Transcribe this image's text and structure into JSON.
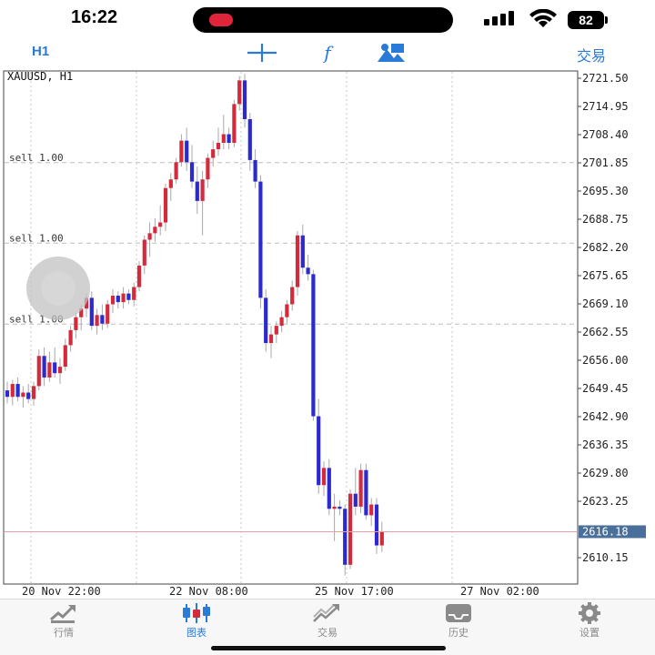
{
  "status_bar": {
    "time": "16:22",
    "battery": "82"
  },
  "toolbar": {
    "timeframe": "H1",
    "trade_label": "交易",
    "icons": [
      "crosshair-icon",
      "indicators-icon",
      "objects-icon"
    ]
  },
  "chart_data": {
    "type": "candlestick",
    "symbol_label": "XAUUSD, H1",
    "y_ticks": [
      "2721.50",
      "2714.95",
      "2708.40",
      "2701.85",
      "2695.30",
      "2688.75",
      "2682.20",
      "2675.65",
      "2669.10",
      "2662.55",
      "2656.00",
      "2649.45",
      "2642.90",
      "2636.35",
      "2629.80",
      "2623.25",
      "2610.15"
    ],
    "x_ticks": [
      "20 Nov 22:00",
      "22 Nov 08:00",
      "25 Nov 17:00",
      "27 Nov 02:00"
    ],
    "current_price": "2616.18",
    "order_lines": [
      {
        "label": "sell 1.00",
        "price": 2701.9
      },
      {
        "label": "sell 1.00",
        "price": 2683.2
      },
      {
        "label": "sell 1.00",
        "price": 2664.4
      }
    ],
    "candles": [
      [
        2649.0,
        2651.0,
        2646.0,
        2647.5
      ],
      [
        2647.5,
        2651.5,
        2645.5,
        2650.5
      ],
      [
        2650.5,
        2652.0,
        2646.5,
        2647.5
      ],
      [
        2647.5,
        2650.0,
        2645.0,
        2648.5
      ],
      [
        2648.5,
        2650.5,
        2646.0,
        2647.0
      ],
      [
        2647.0,
        2651.0,
        2645.5,
        2650.0
      ],
      [
        2650.0,
        2658.5,
        2649.0,
        2657.0
      ],
      [
        2657.0,
        2659.0,
        2650.0,
        2652.0
      ],
      [
        2652.0,
        2658.0,
        2651.0,
        2655.5
      ],
      [
        2655.5,
        2659.0,
        2652.0,
        2653.0
      ],
      [
        2653.0,
        2656.5,
        2650.5,
        2654.5
      ],
      [
        2654.5,
        2661.0,
        2653.5,
        2659.5
      ],
      [
        2659.5,
        2664.0,
        2658.0,
        2663.0
      ],
      [
        2663.0,
        2667.0,
        2661.0,
        2666.0
      ],
      [
        2666.0,
        2669.0,
        2663.0,
        2668.0
      ],
      [
        2668.0,
        2671.5,
        2666.0,
        2670.5
      ],
      [
        2670.5,
        2672.0,
        2663.0,
        2664.0
      ],
      [
        2664.0,
        2668.0,
        2662.0,
        2666.5
      ],
      [
        2666.5,
        2669.0,
        2663.0,
        2664.5
      ],
      [
        2664.5,
        2670.0,
        2663.5,
        2669.0
      ],
      [
        2669.0,
        2672.5,
        2667.0,
        2671.0
      ],
      [
        2671.0,
        2672.0,
        2668.0,
        2669.5
      ],
      [
        2669.5,
        2673.0,
        2668.0,
        2671.5
      ],
      [
        2671.5,
        2672.5,
        2669.0,
        2670.0
      ],
      [
        2670.0,
        2674.0,
        2668.5,
        2673.0
      ],
      [
        2673.0,
        2679.0,
        2672.0,
        2678.0
      ],
      [
        2678.0,
        2685.0,
        2676.0,
        2684.0
      ],
      [
        2684.0,
        2688.0,
        2680.0,
        2685.5
      ],
      [
        2685.5,
        2689.0,
        2683.5,
        2687.0
      ],
      [
        2687.0,
        2692.0,
        2685.0,
        2688.0
      ],
      [
        2688.0,
        2697.0,
        2686.0,
        2696.0
      ],
      [
        2696.0,
        2699.5,
        2693.0,
        2698.0
      ],
      [
        2698.0,
        2703.0,
        2697.0,
        2702.0
      ],
      [
        2702.0,
        2708.5,
        2701.0,
        2707.0
      ],
      [
        2707.0,
        2710.0,
        2700.0,
        2702.0
      ],
      [
        2702.0,
        2706.0,
        2696.0,
        2697.5
      ],
      [
        2697.5,
        2701.0,
        2690.0,
        2693.0
      ],
      [
        2693.0,
        2700.0,
        2685.0,
        2698.0
      ],
      [
        2698.0,
        2704.0,
        2696.0,
        2703.0
      ],
      [
        2703.0,
        2707.0,
        2701.0,
        2705.0
      ],
      [
        2705.0,
        2710.0,
        2703.5,
        2706.5
      ],
      [
        2706.5,
        2713.0,
        2705.0,
        2708.5
      ],
      [
        2708.5,
        2710.0,
        2705.0,
        2706.5
      ],
      [
        2706.5,
        2716.5,
        2705.5,
        2715.5
      ],
      [
        2715.5,
        2722.0,
        2714.0,
        2721.0
      ],
      [
        2721.0,
        2722.5,
        2710.0,
        2712.0
      ],
      [
        2712.0,
        2713.5,
        2700.0,
        2702.5
      ],
      [
        2702.5,
        2705.0,
        2696.0,
        2697.5
      ],
      [
        2697.5,
        2699.0,
        2668.0,
        2670.5
      ],
      [
        2670.5,
        2672.5,
        2658.0,
        2660.0
      ],
      [
        2660.0,
        2664.0,
        2656.5,
        2662.0
      ],
      [
        2662.0,
        2665.0,
        2660.0,
        2664.0
      ],
      [
        2664.0,
        2667.5,
        2662.5,
        2666.0
      ],
      [
        2666.0,
        2670.0,
        2664.5,
        2669.0
      ],
      [
        2669.0,
        2674.5,
        2667.5,
        2673.0
      ],
      [
        2673.0,
        2686.0,
        2671.0,
        2685.0
      ],
      [
        2685.0,
        2687.5,
        2676.0,
        2677.5
      ],
      [
        2677.5,
        2680.5,
        2674.5,
        2676.0
      ],
      [
        2676.0,
        2677.0,
        2642.0,
        2643.0
      ],
      [
        2643.0,
        2647.0,
        2625.0,
        2627.0
      ],
      [
        2627.0,
        2632.5,
        2624.5,
        2631.0
      ],
      [
        2631.0,
        2633.0,
        2620.0,
        2621.5
      ],
      [
        2621.5,
        2625.0,
        2614.0,
        2622.0
      ],
      [
        2622.0,
        2623.5,
        2620.0,
        2621.5
      ],
      [
        2621.5,
        2622.5,
        2606.0,
        2608.5
      ],
      [
        2608.5,
        2626.0,
        2607.5,
        2625.0
      ],
      [
        2625.0,
        2631.0,
        2620.0,
        2622.0
      ],
      [
        2622.0,
        2632.0,
        2620.5,
        2630.5
      ],
      [
        2630.5,
        2632.0,
        2619.0,
        2620.0
      ],
      [
        2620.0,
        2624.0,
        2617.5,
        2622.5
      ],
      [
        2622.5,
        2624.0,
        2611.0,
        2613.0
      ],
      [
        2613.0,
        2618.5,
        2611.5,
        2616.2
      ]
    ]
  },
  "tabs": [
    {
      "label": "行情",
      "icon": "quotes-icon",
      "active": false
    },
    {
      "label": "图表",
      "icon": "chart-candles-icon",
      "active": true
    },
    {
      "label": "交易",
      "icon": "trade-icon",
      "active": false
    },
    {
      "label": "历史",
      "icon": "history-icon",
      "active": false
    },
    {
      "label": "设置",
      "icon": "settings-icon",
      "active": false
    }
  ],
  "colors": {
    "accent": "#2a7ad8",
    "bull": "#d42b3c",
    "bear": "#2a2ad0",
    "price_line": "#e8a0a8"
  }
}
